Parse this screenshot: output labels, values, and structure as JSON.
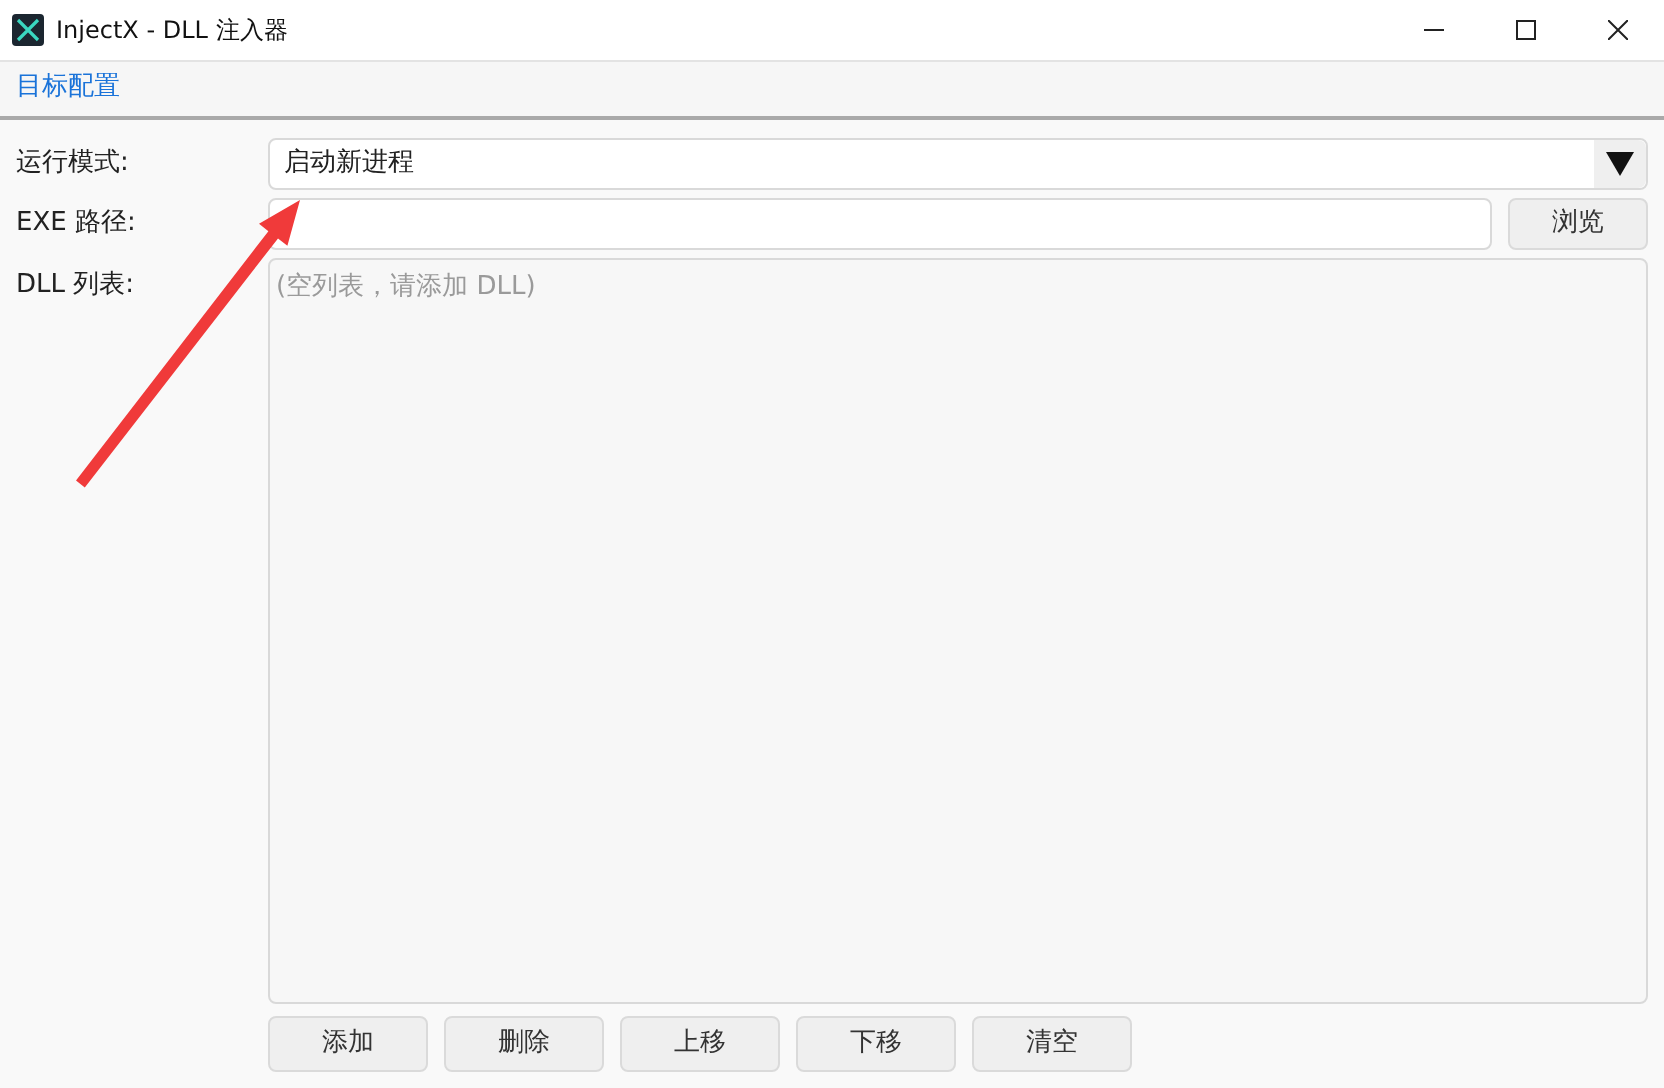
{
  "window": {
    "title": "InjectX - DLL 注入器"
  },
  "tabs": [
    {
      "label": "目标配置",
      "selected": true
    }
  ],
  "form": {
    "mode": {
      "label": "运行模式:",
      "value": "启动新进程"
    },
    "exe_path": {
      "label": "EXE 路径:",
      "browse": "浏览"
    },
    "dll_list": {
      "label": "DLL 列表:",
      "empty_hint": "(空列表，请添加 DLL)"
    }
  },
  "buttons": [
    "添加",
    "删除",
    "上移",
    "下移",
    "清空"
  ]
}
